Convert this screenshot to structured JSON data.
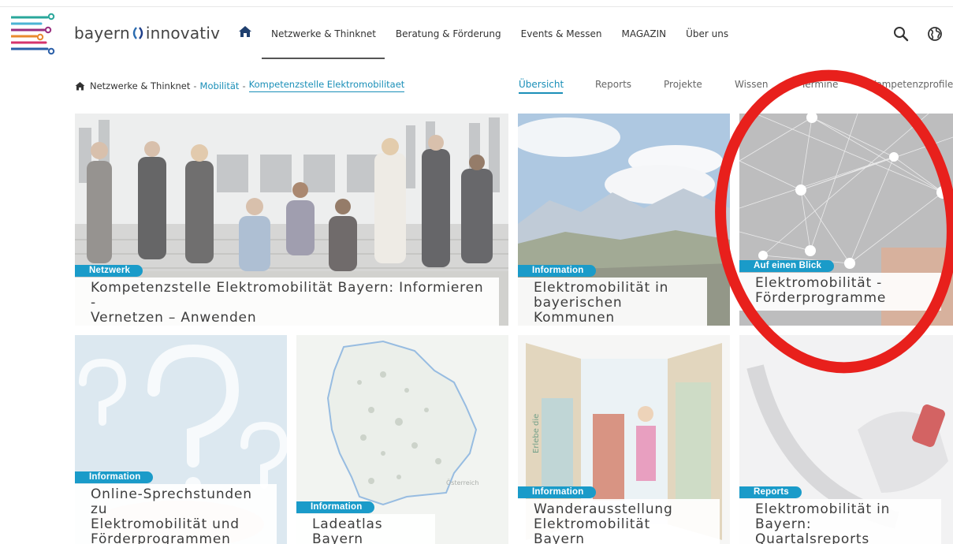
{
  "header": {
    "brand_left": "bayern",
    "brand_right": "innovativ",
    "nav": [
      "Netzwerke & Thinknet",
      "Beratung & Förderung",
      "Events & Messen",
      "MAGAZIN",
      "Über uns"
    ],
    "icons": {
      "home": "home-icon",
      "search": "search-icon",
      "language": "globe-icon"
    }
  },
  "breadcrumb": {
    "root": "Netzwerke & Thinknet",
    "sep": "-",
    "level2": "Mobilität",
    "current": "Kompetenzstelle Elektromobilitaet"
  },
  "subnav": {
    "items": [
      "Übersicht",
      "Reports",
      "Projekte",
      "Wissen",
      "Termine",
      "Kompetenzprofile"
    ],
    "active": "Übersicht"
  },
  "tiles": [
    {
      "badge": "Netzwerk",
      "title_lines": [
        "Kompetenzstelle Elektromobilität Bayern: Informieren -",
        "Vernetzen – Anwenden"
      ]
    },
    {
      "badge": "Information",
      "title_lines": [
        "Elektromobilität in",
        "bayerischen Kommunen"
      ]
    },
    {
      "badge": "Auf einen Blick",
      "title_lines": [
        "Elektromobilität -",
        "Förderprogramme"
      ]
    },
    {
      "badge": "Information",
      "title_lines": [
        "Online-Sprechstunden zu",
        "Elektromobilität und",
        "Förderprogrammen"
      ]
    },
    {
      "badge": "Information",
      "title_lines": [
        "Ladeatlas Bayern"
      ]
    },
    {
      "badge": "Information",
      "title_lines": [
        "Wanderausstellung",
        "Elektromobilität Bayern"
      ]
    },
    {
      "badge": "Reports",
      "title_lines": [
        "Elektromobilität in",
        "Bayern: Quartalsreports"
      ]
    }
  ],
  "map_labels": {
    "austria": "Österreich"
  },
  "exhibit_labels": {
    "side_text": "Erlebe die"
  },
  "colors": {
    "accent": "#1a9bc9",
    "annotation": "#e8201c",
    "text": "#333333"
  }
}
